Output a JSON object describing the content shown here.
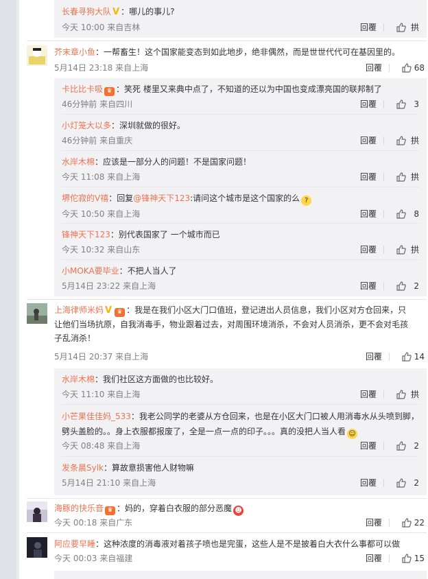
{
  "reply_label": "回覆",
  "comments": [
    {
      "sub_top": {
        "username": "长春寻狗大队",
        "badge": "V",
        "text": "：哪儿的事儿?",
        "time": "今天 10:00 来自吉林",
        "likes": "拱"
      }
    },
    {
      "username": "芥末章小鱼",
      "text": "：一帮畜生！这个国家能变态到如此地步，绝非偶然，而是世世代代可在基因里的。",
      "time": "5月14日 23:18 来自上海",
      "likes": "68",
      "replies": [
        {
          "username": "卡比比卡吸",
          "text": "：笑死 楼里又来典中点了，不知道的还以为中国也变成漂亮国的联邦制了",
          "time": "46分钟前 来自四川",
          "likes": "3"
        },
        {
          "username": "小灯笼大以多",
          "text": "：深圳就做的很好。",
          "time": "46分钟前 来自重庆",
          "likes": "拱"
        },
        {
          "username": "水岸木棉",
          "text": "：应该是一部分人的问题！不是国家问题！",
          "time": "今天 11:08 来自上海",
          "likes": "拱"
        },
        {
          "username": "堺佗寂的V禧",
          "text_pre": "：回复",
          "mention": "@锋神天下123",
          "text": ":请问这个城市是这个国家的么",
          "time": "今天 10:50 来自上海",
          "likes": "8"
        },
        {
          "username": "锋神天下123",
          "text": "：别代表国家了 一个城市而已",
          "time": "今天 10:32 来自山东",
          "likes": "拱"
        },
        {
          "username": "小MOKA要毕业",
          "text": "：不把人当人了",
          "time": "5月14日 23:22 来自上海",
          "likes": "2"
        }
      ]
    },
    {
      "username": "上海律师米妈",
      "badge": "V",
      "text": "：我是在我们小区大门口值班，登记进出人员信息，我们小区对方仓回来，只让他们当场抗原，自我消毒手，物业跟着过去，对周围环境消杀，不会对人员消杀，更不会对毛孩子乱消杀！",
      "time": "5月14日 20:37 来自上海",
      "likes": "14",
      "replies": [
        {
          "username": "水岸木棉",
          "text": "：我们社区这方面做的也比较好。",
          "time": "今天 11:10 来自上海",
          "likes": "拱"
        },
        {
          "username": "小芒果佳佳妈_533",
          "text": "：我老公同学的老婆从方仓回来，也是在小区大门口被人用消毒水从头喷到脚，劈头盖脸的。。身上衣服都报废了，全是一点一点的印子。。。真的没把人当人看",
          "time": "今天 08:48 来自上海",
          "likes": "2"
        },
        {
          "username": "发条晨Sylk",
          "text": "：算故意损害他人财物嘛",
          "time": "5月14日 21:10 来自上海",
          "likes": "2"
        }
      ]
    },
    {
      "username": "海豚的快乐音",
      "text": "：妈的，穿着白衣服的部分恶魔",
      "time": "今天 00:18 来自广东",
      "likes": "22"
    },
    {
      "username": "阿应要早睡",
      "text": "：这种浓度的消毒液对着孩子喷也是完蛋，这些人是不是披着白大衣什么事都可以做",
      "time": "今天 00:03 来自福建",
      "likes": "15"
    }
  ]
}
